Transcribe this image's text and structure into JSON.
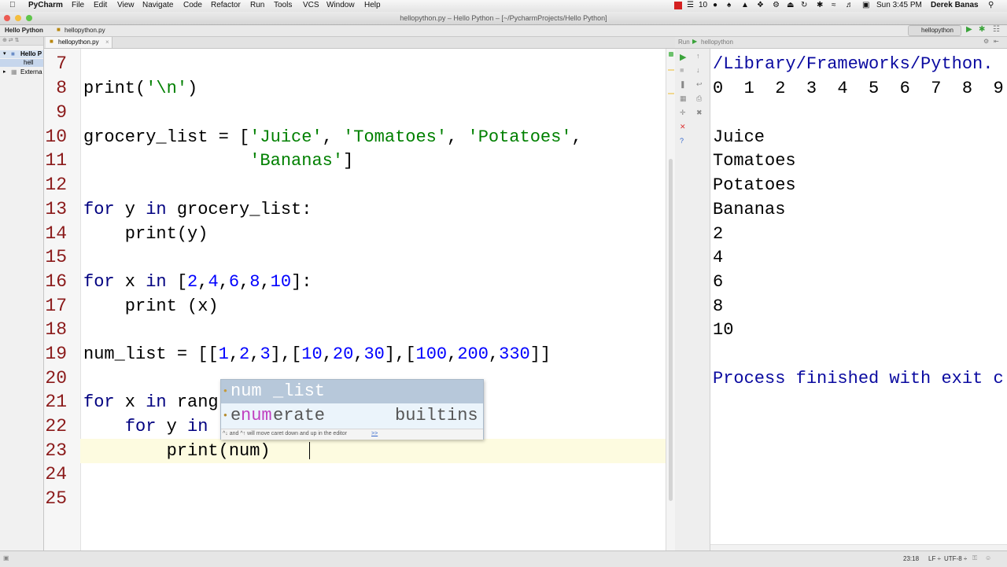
{
  "menubar": {
    "app": "PyCharm",
    "items": [
      "File",
      "Edit",
      "View",
      "Navigate",
      "Code",
      "Refactor",
      "Run",
      "Tools",
      "VCS",
      "Window",
      "Help"
    ],
    "clock": "Sun 3:45 PM",
    "user": "Derek Banas",
    "badge": "10"
  },
  "window": {
    "title": "hellopython.py – Hello Python – [~/PycharmProjects/Hello Python]"
  },
  "navbar": {
    "crumbs": [
      "Hello Python",
      "hellopython.py"
    ],
    "run_config": "hellopython"
  },
  "project": {
    "items": [
      "Hello P",
      "hell",
      "Externa"
    ]
  },
  "editor": {
    "tab": "hellopython.py",
    "line_numbers": [
      "7",
      "8",
      "9",
      "10",
      "11",
      "12",
      "13",
      "14",
      "15",
      "16",
      "17",
      "18",
      "19",
      "20",
      "21",
      "22",
      "23",
      "24",
      "25"
    ],
    "code": {
      "l8a": "print(",
      "l8s": "'\\n'",
      "l8b": ")",
      "l10a": "grocery_list = [",
      "l10s1": "'Juice'",
      "l10c1": ", ",
      "l10s2": "'Tomatoes'",
      "l10c2": ", ",
      "l10s3": "'Potatoes'",
      "l10c3": ",",
      "l11pad": "                ",
      "l11s": "'Bananas'",
      "l11b": "]",
      "l13k1": "for",
      "l13a": " y ",
      "l13k2": "in",
      "l13b": " grocery_list:",
      "l14": "    print(y)",
      "l16k1": "for",
      "l16a": " x ",
      "l16k2": "in",
      "l16b": " [",
      "l16n": [
        "2",
        "4",
        "6",
        "8",
        "10"
      ],
      "l16c": "]:",
      "l17": "    print (x)",
      "l19a": "num_list = [[",
      "l19n1": [
        "1",
        "2",
        "3"
      ],
      "l19n2": [
        "10",
        "20",
        "30"
      ],
      "l19n3": [
        "100",
        "200",
        "330"
      ],
      "l21k1": "for",
      "l21a": " x ",
      "l21k2": "in",
      "l21b": " rang",
      "l22pad": "    ",
      "l22k1": "for",
      "l22a": " y ",
      "l22k2": "in",
      "l23": "        print(num)"
    }
  },
  "popup": {
    "items": [
      {
        "name": "num_list",
        "match": "num",
        "rest": "_list",
        "type": ""
      },
      {
        "name": "enumerate",
        "pre": "e",
        "match": "num",
        "rest": "erate",
        "type": "builtins"
      }
    ],
    "hint": "^↓ and ^↑ will move caret down and up in the editor",
    "hint_link": ">>"
  },
  "run_panel": {
    "title": "Run",
    "config": "hellopython",
    "output": [
      "/Library/Frameworks/Python.",
      "0  1  2  3  4  5  6  7  8  9",
      "",
      "Juice",
      "Tomatoes",
      "Potatoes",
      "Bananas",
      "2",
      "4",
      "6",
      "8",
      "10",
      "",
      "Process finished with exit c"
    ]
  },
  "status": {
    "position": "23:18",
    "separator": "LF ÷",
    "encoding": "UTF-8 ÷"
  }
}
